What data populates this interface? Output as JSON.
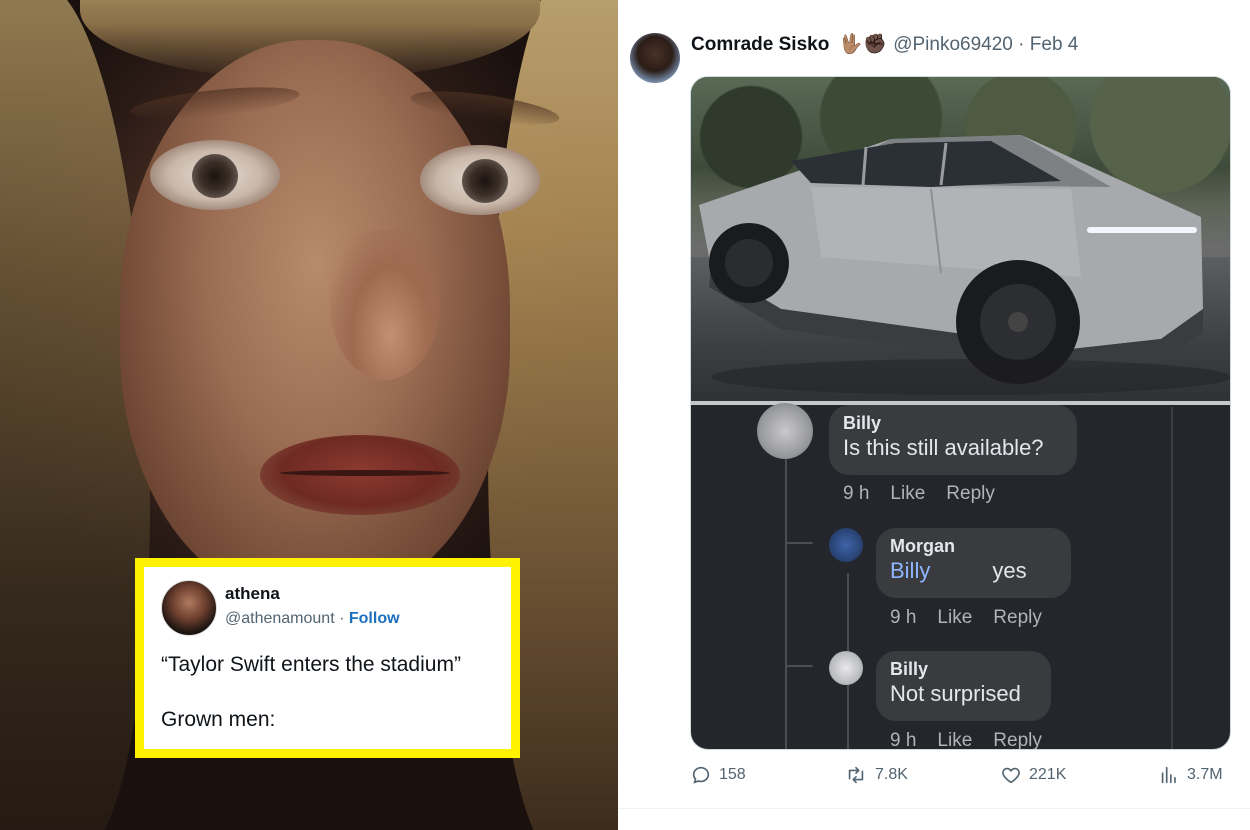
{
  "left_tweet": {
    "display_name": "athena",
    "handle": "@athenamount",
    "separator": " · ",
    "follow_label": "Follow",
    "text_line1": "“Taylor Swift enters the stadium”",
    "text_line2": "Grown men:",
    "frame_color": "#fff200"
  },
  "right_tweet": {
    "display_name": "Comrade Sisko",
    "name_emoji": "🖖🏽✊🏿",
    "handle": "@Pinko69420",
    "separator": " · ",
    "date": "Feb 4",
    "comments": [
      {
        "name": "Billy",
        "text": "Is this still available?",
        "time": "9 h",
        "like": "Like",
        "reply": "Reply"
      },
      {
        "name": "Morgan",
        "mention": "Billy",
        "text": "yes",
        "time": "9 h",
        "like": "Like",
        "reply": "Reply"
      },
      {
        "name": "Billy",
        "text": "Not surprised",
        "time": "9 h",
        "like": "Like",
        "reply": "Reply"
      }
    ],
    "actions": {
      "replies": "158",
      "retweets": "7.8K",
      "likes": "221K",
      "views": "3.7M"
    }
  },
  "colors": {
    "link_blue": "#1d6fbf",
    "comment_bubble": "#3a3b3f",
    "muted_text": "#536471"
  }
}
